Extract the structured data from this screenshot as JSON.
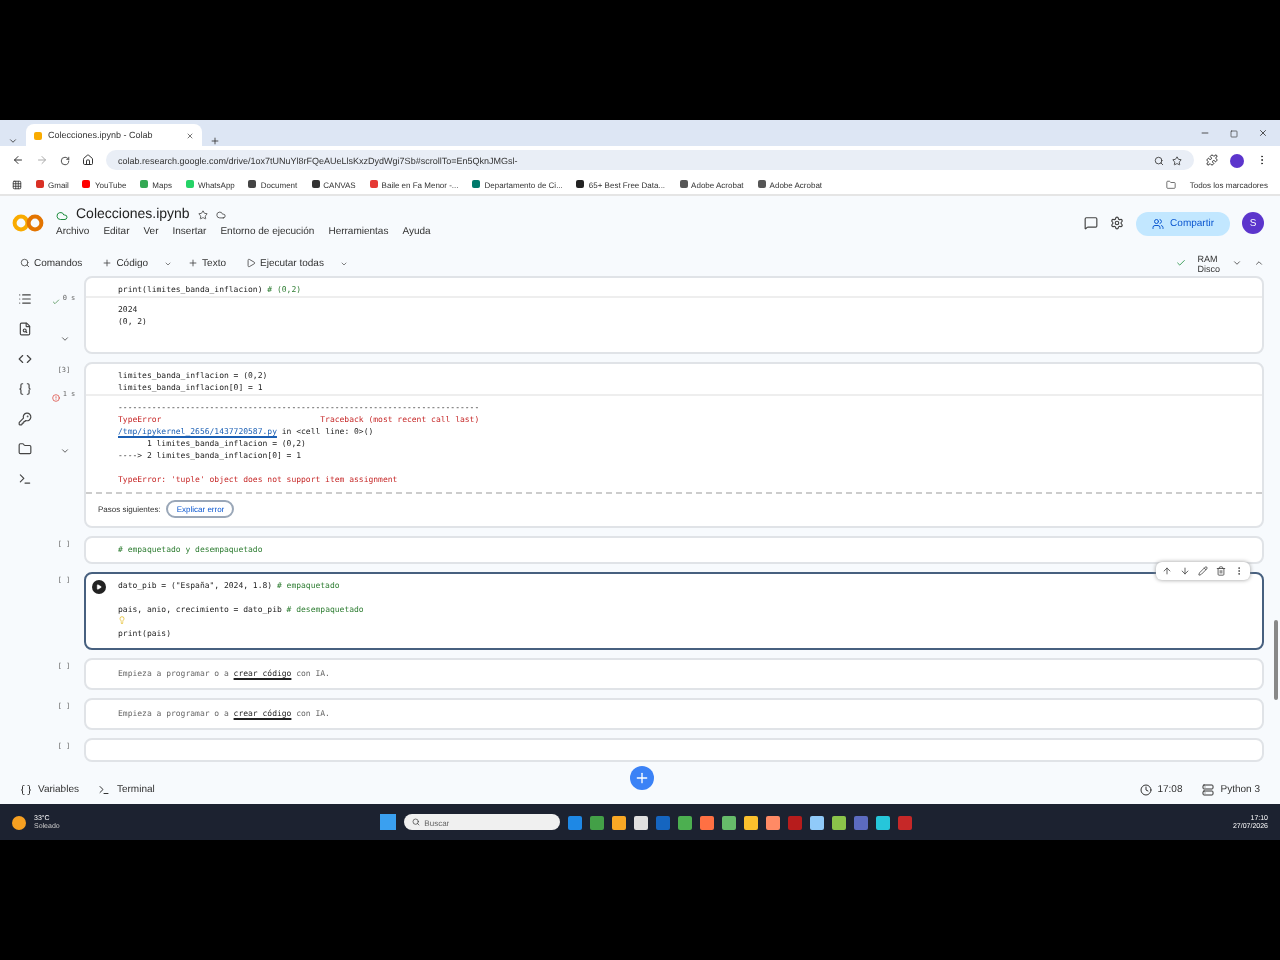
{
  "browser": {
    "tabs": [
      {
        "title": "Colecciones.ipynb - Colab",
        "selected": true
      }
    ],
    "url": "colab.research.google.com/drive/1ox7tUNuYl8rFQeAUeLlsKxzDydWgi7Sb#scrollTo=En5QknJMGsl-",
    "bookmarks": [
      {
        "label": "Gmail",
        "color": "#d93025"
      },
      {
        "label": "YouTube",
        "color": "#ff0000"
      },
      {
        "label": "Maps",
        "color": "#34a853"
      },
      {
        "label": "WhatsApp",
        "color": "#25d366"
      },
      {
        "label": "Document",
        "color": "#444444"
      },
      {
        "label": "CANVAS",
        "color": "#333333"
      },
      {
        "label": "Baile en Fa Menor -...",
        "color": "#e53935"
      },
      {
        "label": "Departamento de Ci...",
        "color": "#00796b"
      },
      {
        "label": "65+ Best Free Data...",
        "color": "#222222"
      },
      {
        "label": "Adobe Acrobat",
        "color": "#555555"
      },
      {
        "label": "Adobe Acrobat",
        "color": "#555555"
      }
    ],
    "all_bookmarks": "Todos los marcadores"
  },
  "colab": {
    "notebook_title": "Colecciones.ipynb",
    "menu": [
      "Archivo",
      "Editar",
      "Ver",
      "Insertar",
      "Entorno de ejecución",
      "Herramientas",
      "Ayuda"
    ],
    "share_button": "Compartir",
    "avatar": "S",
    "toolbar": [
      {
        "kind": "search",
        "label": "Comandos"
      },
      {
        "kind": "add",
        "label": "Código"
      },
      {
        "kind": "add",
        "label": "Texto"
      },
      {
        "kind": "run",
        "label": "Ejecutar todas"
      }
    ],
    "ram_label": "RAM",
    "disk_label": "Disco"
  },
  "cells": [
    {
      "kind": "code",
      "status": "0 s",
      "error": false,
      "code": [
        "print(limites_banda_inflacion) # (0,2)"
      ],
      "output": [
        "2024",
        "(0, 2)"
      ]
    },
    {
      "kind": "code",
      "count": "[3]",
      "status": "1 s",
      "error": true,
      "code": [
        "limites_banda_inflacion = (0,2)",
        "limites_banda_inflacion[0] = 1"
      ],
      "traceback": {
        "rule": "---------------------------------------------------------------------------",
        "header": "TypeError                                 Traceback (most recent call last)",
        "file_link": "/tmp/ipykernel_2656/1437720587.py",
        "file_rest": " in <cell line: 0>()",
        "lines": [
          "      1 limites_banda_inflacion = (0,2)",
          "----> 2 limites_banda_inflacion[0] = 1"
        ],
        "message": "TypeError: 'tuple' object does not support item assignment"
      },
      "next_steps": "Pasos siguientes:",
      "explain_button": "Explicar error"
    },
    {
      "kind": "code",
      "count": "[ ]",
      "code": [
        "# empaquetado y desempaquetado"
      ]
    },
    {
      "kind": "active",
      "count": "[ ]",
      "code": [
        "dato_pib = (\"España\", 2024, 1.8) # empaquetado",
        "pais, anio, crecimiento = dato_pib # desempaquetado",
        "print(pais)"
      ]
    },
    {
      "kind": "empty",
      "count": "[ ]",
      "before": "Empieza a programar o a ",
      "link": "crear código",
      "after": " con IA."
    },
    {
      "kind": "empty",
      "count": "[ ]",
      "before": "Empieza a programar o a ",
      "link": "crear código",
      "after": " con IA."
    },
    {
      "kind": "partial",
      "count": "[ ]"
    }
  ],
  "status_bar": {
    "variables": "Variables",
    "terminal": "Terminal",
    "time": "17:08",
    "runtime": "Python 3"
  },
  "taskbar": {
    "temperature": "33°C",
    "weather": "Soleado",
    "search_placeholder": "Buscar",
    "time": "17:10",
    "date": "27/07/2026"
  }
}
